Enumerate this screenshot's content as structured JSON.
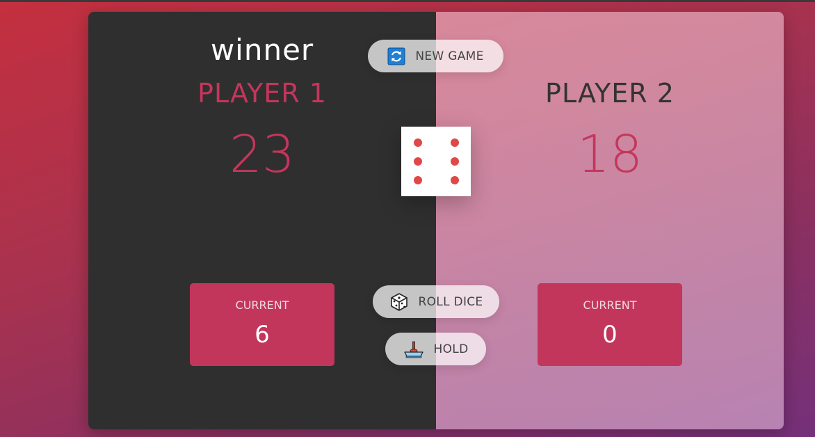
{
  "winner_label": "winner",
  "players": [
    {
      "name": "PLAYER 1",
      "score": "23",
      "current_label": "CURRENT",
      "current_value": "6"
    },
    {
      "name": "PLAYER 2",
      "score": "18",
      "current_label": "CURRENT",
      "current_value": "0"
    }
  ],
  "buttons": {
    "new_game": {
      "label": "NEW GAME",
      "icon": "refresh-icon"
    },
    "roll_dice": {
      "label": "ROLL DICE",
      "icon": "dice-icon"
    },
    "hold": {
      "label": "HOLD",
      "icon": "joystick-icon"
    }
  },
  "dice": {
    "value": 6
  },
  "colors": {
    "accent": "#c4365c",
    "active_panel": "#2f2f2f",
    "pip": "#e04848"
  }
}
